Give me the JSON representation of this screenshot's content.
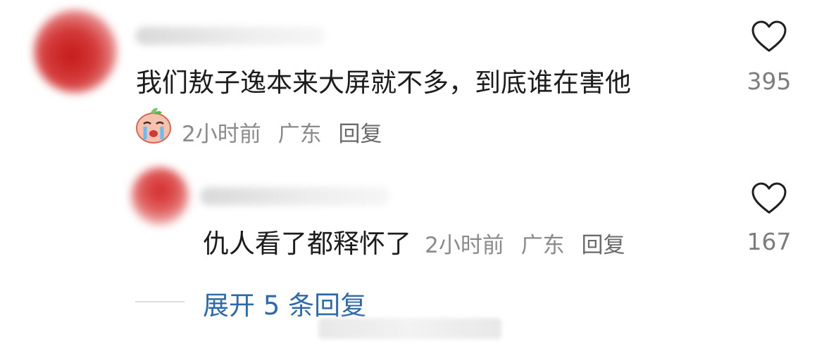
{
  "comments": [
    {
      "text": "我们敖子逸本来大屏就不多，到底谁在害他",
      "time": "2小时前",
      "location": "广东",
      "reply_label": "回复",
      "likes": "395",
      "sticker_icon": "crying-peach-sticker-icon"
    },
    {
      "text": "仇人看了都释怀了",
      "time": "2小时前",
      "location": "广东",
      "reply_label": "回复",
      "likes": "167"
    }
  ],
  "expand_replies": "展开 5 条回复",
  "colors": {
    "link": "#2f6aa6",
    "meta": "#8a8a8a",
    "text": "#1c1c1c"
  }
}
